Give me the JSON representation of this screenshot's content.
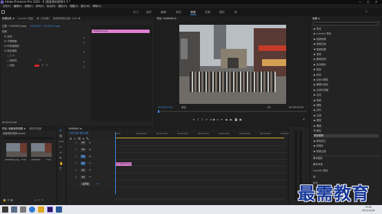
{
  "app": {
    "title": "Adobe Premiere Pro 2020 - E:\\我爱我的视频\\1.5 *"
  },
  "window_controls": {
    "min": "—",
    "max": "□",
    "close": "✕"
  },
  "menubar": {
    "items": [
      "文件(F)",
      "编辑(E)",
      "剪辑(C)",
      "序列(S)",
      "标记(M)",
      "图形(G)",
      "视图(V)",
      "窗口(W)",
      "帮助(H)"
    ]
  },
  "workspaces": {
    "items": [
      "学习",
      "组件",
      "编辑",
      "颜色",
      "效果",
      "音频",
      "图形",
      "库"
    ],
    "active": "效果"
  },
  "effect_controls": {
    "tabs": [
      "效果控件 ≡",
      "Lumetri 范围",
      "源: (无剪辑)",
      "音频剪辑混合器: 1000 ▼"
    ],
    "master": "主要 * 1000000.jpeg",
    "clip": "1000000 * 1000000.jpeg",
    "video_header": "视频",
    "rows": [
      "fx 运动",
      "fx 不透明度",
      "fx 时间重映射",
      "fx 颜色替换"
    ],
    "sub_rows": [
      "○ □ ✎",
      "○ 相似性",
      "○ 纯色"
    ],
    "similarity_value": "15",
    "solid_label": "纯色",
    "time_readout": "00:00:00:00",
    "clip_name": "1000000.jpeg"
  },
  "program_monitor": {
    "tab": "节目: 1000000 ≡",
    "timecode_left": "00:00:00:00",
    "fit": "适合",
    "ratio": "1/2",
    "timecode_right": "00:00:05:00"
  },
  "project_panel": {
    "tabs": [
      "项目: 我爱我的视频 ≡",
      "媒体浏览器"
    ],
    "file": "我爱我的视频.prproj",
    "items": [
      {
        "name": "1000000.jpeg",
        "duration": "5:00"
      },
      {
        "name": "1000000",
        "duration": "5:00"
      }
    ]
  },
  "timeline": {
    "tab": "1000000 ≡",
    "timecode": "00:00:00:00",
    "ruler": [
      "00:00",
      "00:00:05:00",
      "00:00:10:00",
      "00:00:15:00",
      "00:00:20:00",
      "00:00:25:00",
      "00:00:30:00",
      "00:00:35:00",
      "00:00:40:00"
    ],
    "tracks": [
      "V3",
      "V2",
      "V1",
      "A1",
      "A2",
      "A3",
      "主声道"
    ],
    "master_value": "0.0",
    "clip_label": "fx 1000000.jpeg"
  },
  "effects_panel": {
    "tab": "效果 ≡",
    "items": [
      "▶ 预设",
      "▶ Lumetri 预设",
      "▶ 音频效果",
      "▶ 音频过渡",
      "▼ 视频效果",
      "  ▶ 变换",
      "  ▶ 图像控制",
      "  ▶ 实用程序",
      "  ▶ 扭曲",
      "  ▶ 时间",
      "  ▶ 杂色与颗粒",
      "  ▶ 模糊与锐化",
      "  ▶ 沉浸式视频",
      "  ▶ 生成",
      "  ▶ 视频",
      "  ▶ 调整",
      "  ▶ 过时",
      "  ▶ 过渡",
      "  ▶ 透视",
      "  ▶ 通道",
      "  ▼ 键控",
      "     颜色替换",
      "▶ 颜色校正",
      "▶ 风格化",
      "▶ 视频过渡"
    ],
    "selected": "颜色替换",
    "lower": [
      "基本图形",
      "基本声音",
      "Lumetri 颜色",
      "库",
      "标记"
    ]
  },
  "taskbar": {
    "time": "15:00",
    "date": "2021/11/16"
  },
  "watermark": "最需教育",
  "colors": {
    "accent": "#3d8de6",
    "clip_pink": "#e07fd2",
    "solid_red": "#e02020"
  }
}
